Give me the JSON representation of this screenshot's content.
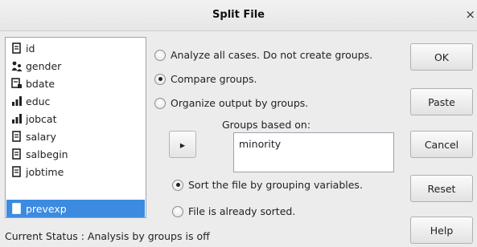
{
  "window": {
    "title": "Split File",
    "close_glyph": "×"
  },
  "variables": [
    {
      "label": "id",
      "icon": "scale-icon"
    },
    {
      "label": "gender",
      "icon": "nominal-icon"
    },
    {
      "label": "bdate",
      "icon": "date-icon"
    },
    {
      "label": "educ",
      "icon": "ordinal-icon"
    },
    {
      "label": "jobcat",
      "icon": "ordinal-icon"
    },
    {
      "label": "salary",
      "icon": "scale-icon"
    },
    {
      "label": "salbegin",
      "icon": "scale-icon"
    },
    {
      "label": "jobtime",
      "icon": "scale-icon"
    },
    {
      "label": "prevexp",
      "icon": "scale-icon",
      "selected": true
    }
  ],
  "options": {
    "analyze_all": "Analyze all cases.  Do not create groups.",
    "compare": "Compare groups.",
    "organize": "Organize output by groups.",
    "selected": "compare"
  },
  "groups": {
    "label": "Groups based on:",
    "items": [
      "minority"
    ],
    "move_button_glyph": "▸"
  },
  "sort": {
    "sort_label": "Sort the file by grouping variables.",
    "sorted_label": "File is already sorted.",
    "selected": "sort"
  },
  "buttons": {
    "ok": "OK",
    "paste": "Paste",
    "cancel": "Cancel",
    "reset": "Reset",
    "help": "Help"
  },
  "status": "Current Status : Analysis by groups is off",
  "colors": {
    "selection": "#3c8be0",
    "background": "#ececec"
  }
}
